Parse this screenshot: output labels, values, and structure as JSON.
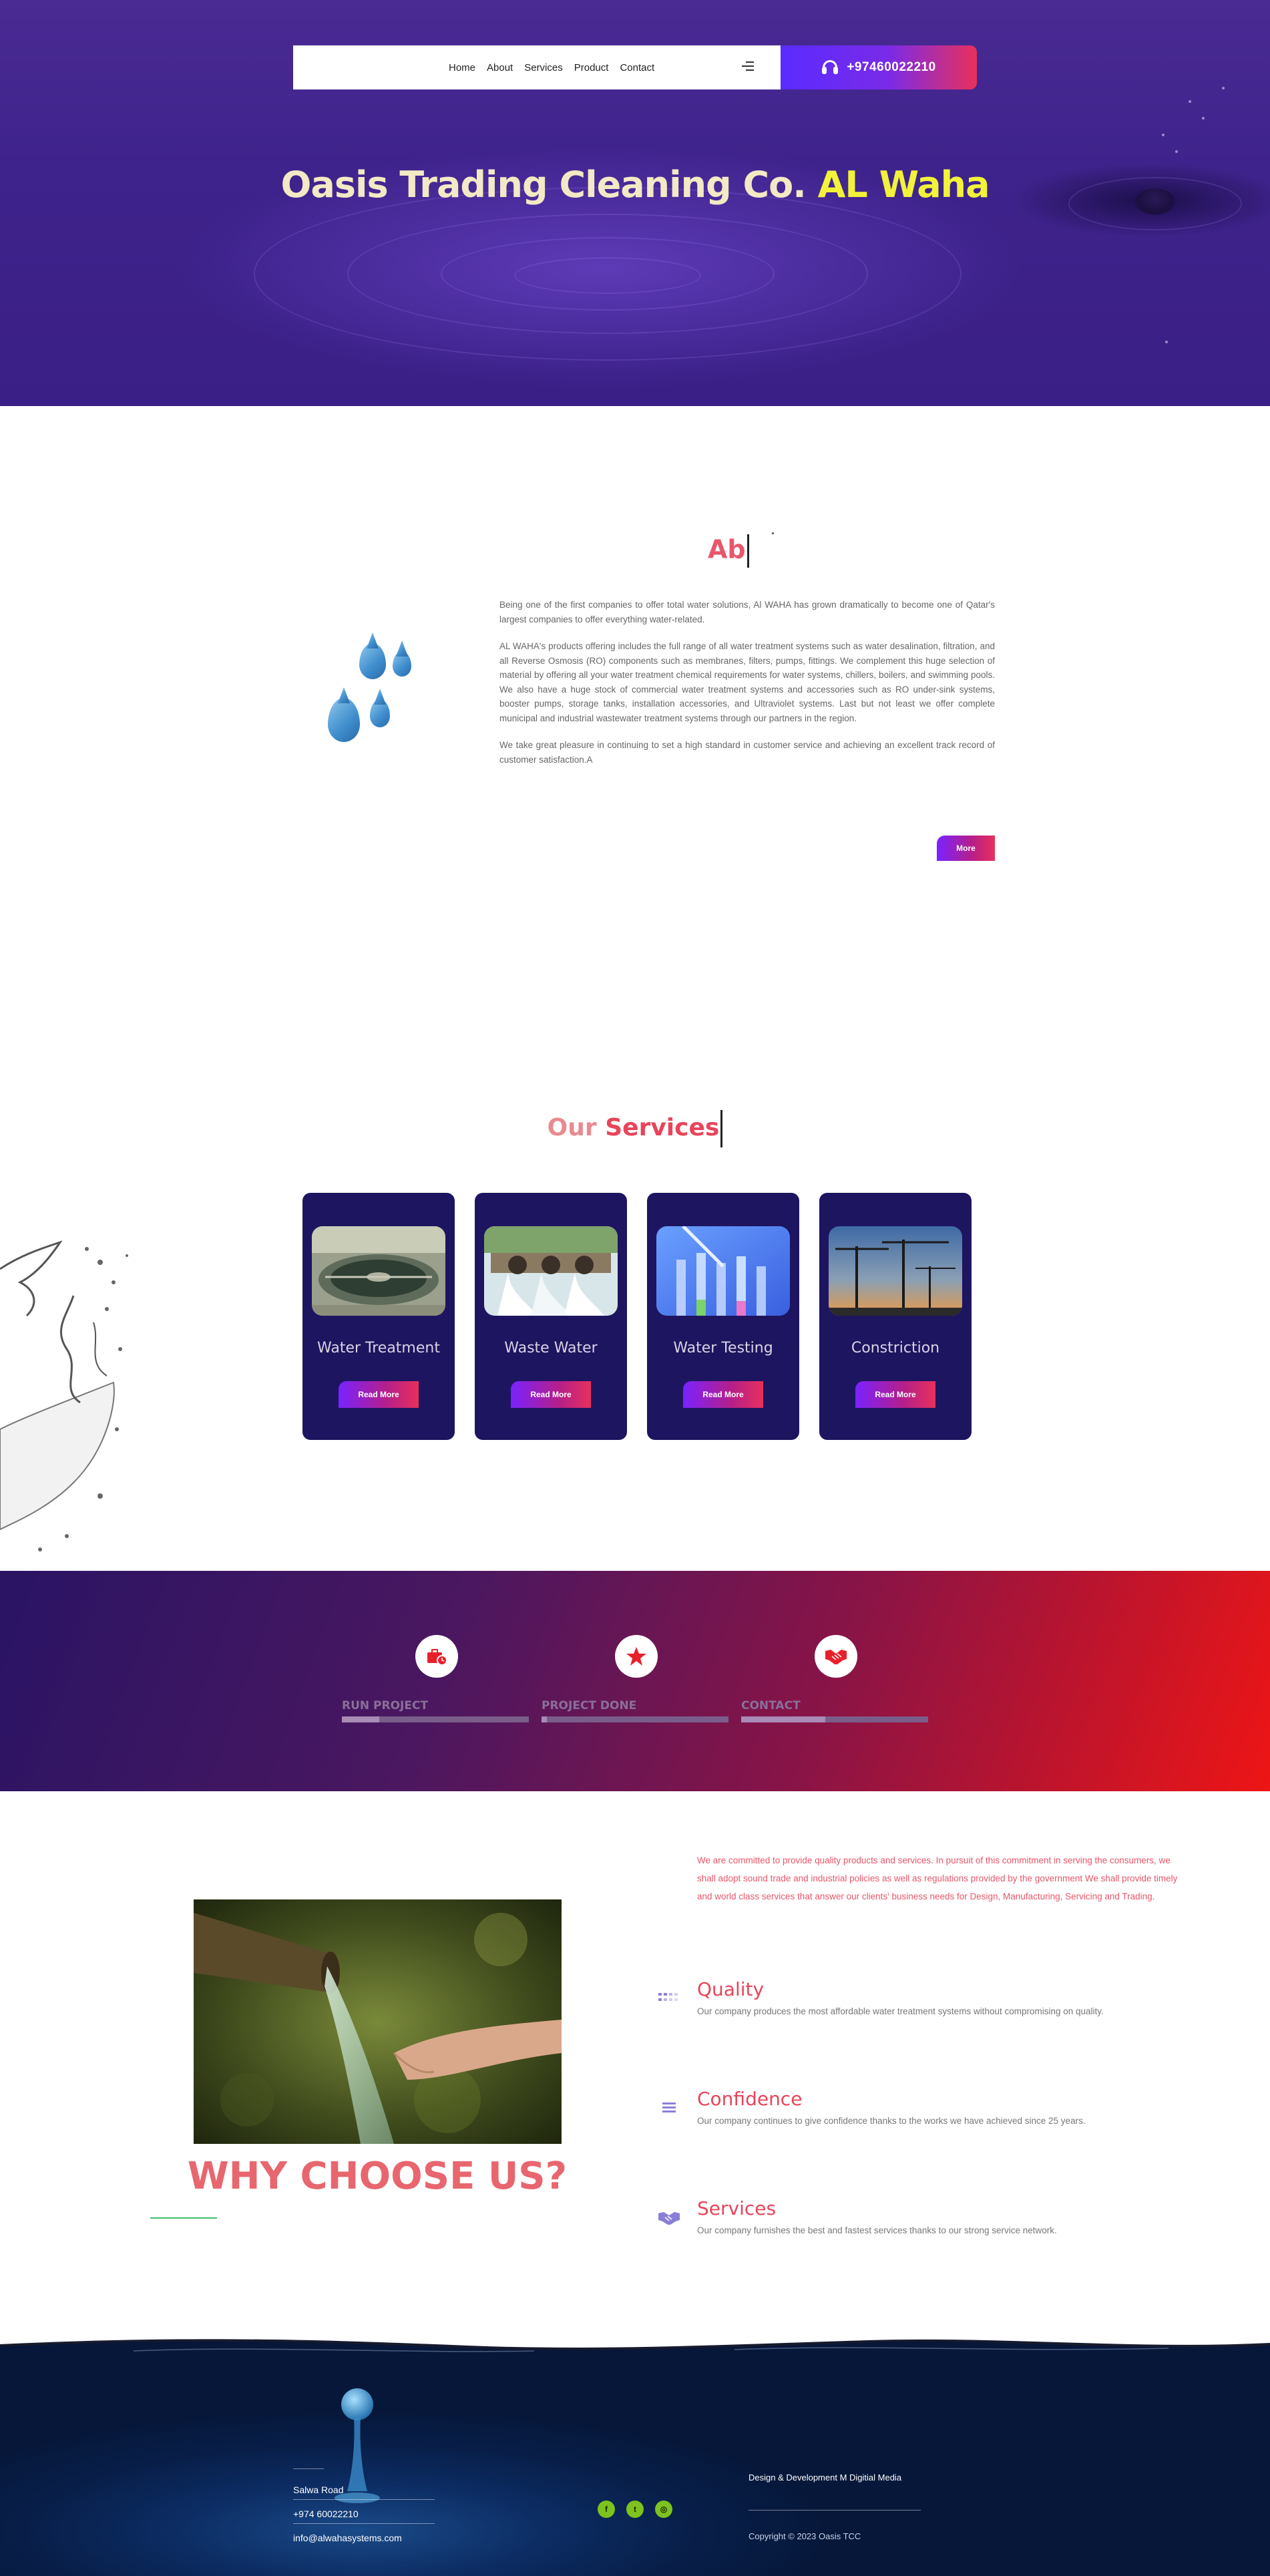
{
  "nav": {
    "links": [
      "Home",
      "About",
      "Services",
      "Product",
      "Contact"
    ],
    "phone": "+97460022210"
  },
  "hero": {
    "title_main": "Oasis Trading Cleaning Co.",
    "title_highlight": "AL Waha"
  },
  "about": {
    "heading": "Ab",
    "paragraphs": [
      "Being one of the first companies to offer total water solutions, Al WAHA has grown dramatically to become one of Qatar's largest companies to offer everything water-related.",
      "AL WAHA's products offering includes the full range of all water treatment systems such as water desalination, filtration, and all Reverse Osmosis (RO) components such as membranes, filters, pumps, fittings. We complement this huge selection of material by offering all your water treatment chemical requirements for water systems, chillers, boilers, and swimming pools. We also have a huge stock of commercial water treatment systems and accessories such as RO under-sink systems, booster pumps, storage tanks, installation accessories, and Ultraviolet systems. Last but not least we offer complete municipal and industrial wastewater treatment systems through our partners in the region.",
      "We take great pleasure in continuing to set a high standard in customer service and achieving an excellent track record of customer satisfaction.A"
    ],
    "more_label": "More"
  },
  "services": {
    "heading_prefix": "Our",
    "heading_main": "Services",
    "cards": [
      {
        "title": "Water Treatment",
        "button": "Read More"
      },
      {
        "title": "Waste Water",
        "button": "Read More"
      },
      {
        "title": "Water Testing",
        "button": "Read More"
      },
      {
        "title": "Constriction",
        "button": "Read More"
      }
    ]
  },
  "stats": [
    {
      "label": "RUN PROJECT",
      "icon": "briefcase-clock-icon",
      "progress": 0.2
    },
    {
      "label": "PROJECT DONE",
      "icon": "star-icon",
      "progress": 0.03
    },
    {
      "label": "CONTACT",
      "icon": "handshake-icon",
      "progress": 0.45
    }
  ],
  "why": {
    "title": "WHY CHOOSE US?",
    "intro": "We are committed to provide quality products and services. In pursuit of this commitment in serving the consumers, we shall adopt sound trade and industrial policies as well as regulations provided by the government We shall provide timely and world class services that answer our clients' business needs for Design, Manufacturing, Servicing and Trading.",
    "features": [
      {
        "title": "Quality",
        "desc": "Our company produces the most affordable water treatment systems without compromising on quality.",
        "icon": "grid-icon"
      },
      {
        "title": "Confidence",
        "desc": "Our company continues to give confidence thanks to the works we have achieved since 25 years.",
        "icon": "list-icon"
      },
      {
        "title": "Services",
        "desc": "Our company furnishes the best and fastest services thanks to our strong service network.",
        "icon": "handshake-icon"
      }
    ]
  },
  "footer": {
    "address": "Salwa Road",
    "phone": "+974 60022210",
    "email": "info@alwahasystems.com",
    "credit": "Design & Development M Digitial Media",
    "copyright": "Copyright © 2023 Oasis TCC",
    "social": [
      {
        "icon": "facebook-icon",
        "glyph": "f"
      },
      {
        "icon": "twitter-icon",
        "glyph": "t"
      },
      {
        "icon": "instagram-icon",
        "glyph": "◎"
      }
    ]
  },
  "colors": {
    "hero_bg": "#3f238c",
    "accent_red": "#e8455a",
    "accent_yellow": "#f2f23a",
    "card_bg": "#1e1560",
    "footer_bg": "#081f4a"
  }
}
